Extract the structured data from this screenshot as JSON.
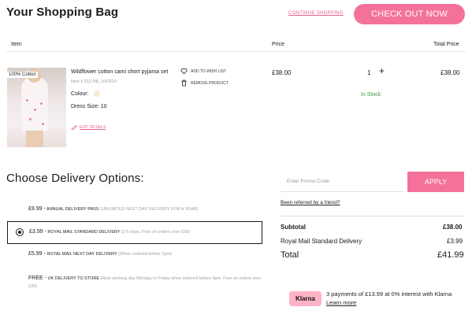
{
  "header": {
    "title": "Your Shopping Bag",
    "continue_label": "CONTINUE SHOPPING",
    "checkout_label": "CHECK OUT NOW"
  },
  "table_headers": {
    "item": "Item",
    "price": "Price",
    "total": "Total Price"
  },
  "product": {
    "badge": "100% Cotton",
    "name": "Wildflower cotton cami short pyjama set",
    "item_code": "Item # 211758_10CR10",
    "colour_label": "Colour:",
    "colour_swatch": "#f7ecd2",
    "size": "Dress Size: 10",
    "edit_label": "EDIT DETAILS",
    "wishlist_label": "ADD TO WISH LIST",
    "remove_label": "REMOVE PRODUCT",
    "price": "£38.00",
    "quantity": "1",
    "quantity_plus": "+",
    "stock": "In Stock",
    "total": "£38.00"
  },
  "delivery": {
    "title": "Choose Delivery Options:",
    "options": [
      {
        "price": "£9.99 -",
        "name": "ANNUAL DELIVERY PASS",
        "note": "(UNLIMITED NEXT DAY DELIVERY FOR A YEAR)",
        "selected": false
      },
      {
        "price": "£3.99 -",
        "name": "ROYAL MAIL STANDARD DELIVERY",
        "note": "(3-5 days. Free on orders over £50)",
        "selected": true
      },
      {
        "price": "£5.99 -",
        "name": "ROYAL MAIL NEXT DAY DELIVERY",
        "note": "(When ordered before 7pm)",
        "selected": false
      },
      {
        "price": "FREE -",
        "name": "UK DELIVERY TO STORE",
        "note": "(Next working day Monday to Friday when ordered before 4pm. Free on orders over £30)",
        "selected": false
      }
    ]
  },
  "promo": {
    "placeholder": "Enter Promo Code",
    "apply_label": "APPLY",
    "referral_link": "Been referred by a friend?"
  },
  "summary": {
    "subtotal_label": "Subtotal",
    "subtotal_value": "£38.00",
    "shipping_label": "Royal Mail Standard Delivery",
    "shipping_value": "£3.99",
    "total_label": "Total",
    "total_value": "£41.99"
  },
  "klarna": {
    "badge": "Klarna",
    "text": "3 payments of £13.99 at 0% interest with Klarna",
    "link": "Learn more"
  },
  "colors": {
    "accent": "#f4729a",
    "link_pink": "#e8618c",
    "in_stock": "#3a9a44",
    "klarna_pink": "#ffb3c7"
  }
}
